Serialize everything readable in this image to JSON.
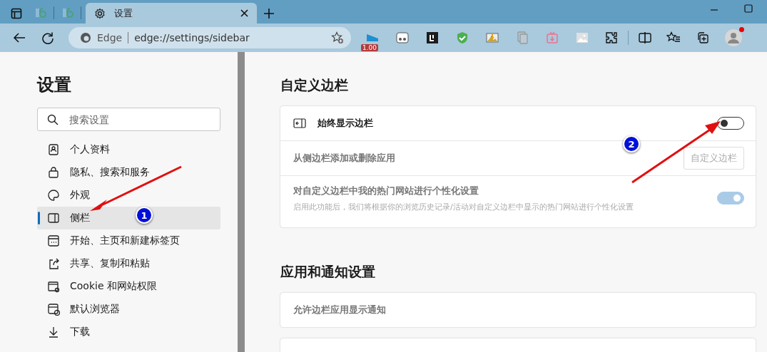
{
  "tabs": [
    {
      "kind": "pinned",
      "selected": false
    },
    {
      "kind": "pinned",
      "selected": false
    },
    {
      "kind": "page",
      "title": "设置",
      "selected": true
    }
  ],
  "address_bar": {
    "site_label": "Edge",
    "url": "edge://settings/sidebar"
  },
  "extension_badge": "1.00",
  "profile": {
    "notification": true
  },
  "sidebar": {
    "title": "设置",
    "search": {
      "placeholder": "搜索设置"
    },
    "items": [
      {
        "label": "个人资料",
        "selected": false
      },
      {
        "label": "隐私、搜索和服务",
        "selected": false
      },
      {
        "label": "外观",
        "selected": false
      },
      {
        "label": "侧栏",
        "selected": true
      },
      {
        "label": "开始、主页和新建标签页",
        "selected": false
      },
      {
        "label": "共享、复制和粘贴",
        "selected": false
      },
      {
        "label": "Cookie 和网站权限",
        "selected": false
      },
      {
        "label": "默认浏览器",
        "selected": false
      },
      {
        "label": "下载",
        "selected": false
      }
    ]
  },
  "sections": [
    {
      "title": "自定义边栏",
      "rows": [
        {
          "kind": "toggle",
          "label": "始终显示边栏",
          "on": false,
          "disabled": false
        },
        {
          "kind": "button",
          "label": "从侧边栏添加或删除应用",
          "button": "自定义边栏",
          "disabled": true
        },
        {
          "kind": "toggle",
          "label": "对自定义边栏中我的热门网站进行个性化设置",
          "description": "启用此功能后，我们将根据你的浏览历史记录/活动对自定义边栏中显示的热门网站进行个性化设置",
          "on": true,
          "disabled": true
        }
      ]
    },
    {
      "title": "应用和通知设置",
      "rows": [
        {
          "kind": "plain",
          "label": "允许边栏应用显示通知",
          "disabled": true
        }
      ]
    }
  ],
  "annotations": [
    {
      "label": "1"
    },
    {
      "label": "2"
    }
  ]
}
